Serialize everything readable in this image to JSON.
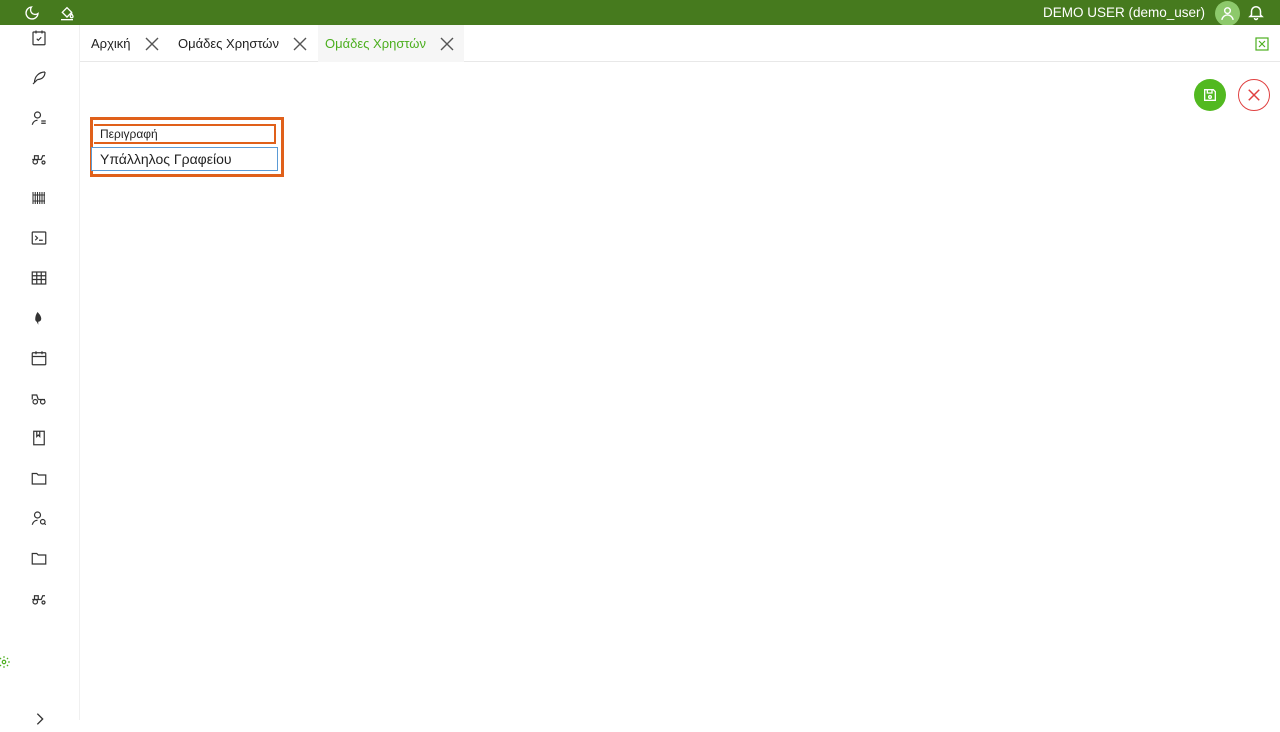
{
  "topbar": {
    "user_name": "DEMO USER (demo_user)",
    "icons": [
      "moon-icon",
      "paint-bucket-icon",
      "user-avatar-icon",
      "bell-icon"
    ],
    "background": "#467a1e"
  },
  "sidebar": {
    "items": [
      "calendar-check-icon",
      "feather-icon",
      "user-list-icon",
      "tractor-icon",
      "barcode-icon",
      "terminal-icon",
      "table-icon",
      "droplet-icon",
      "calendar-icon",
      "tractor-trailer-icon",
      "book-icon",
      "folder-icon",
      "user-search-icon",
      "folder-icon",
      "tractor-icon"
    ],
    "settings_icon": "gear-icon",
    "expand_icon": "chevron-right-icon"
  },
  "tabs": [
    {
      "label": "Αρχική",
      "active": false
    },
    {
      "label": "Ομάδες Χρηστών",
      "active": false
    },
    {
      "label": "Ομάδες Χρηστών",
      "active": true
    }
  ],
  "actions": {
    "export_icon": "excel-icon",
    "save_icon": "save-icon",
    "close_icon": "close-icon"
  },
  "form": {
    "description_label": "Περιγραφή",
    "description_value": "Υπάλληλος Γραφείου"
  },
  "colors": {
    "accent": "#4caf1f",
    "highlight": "#e0601a",
    "danger": "#e04040"
  }
}
